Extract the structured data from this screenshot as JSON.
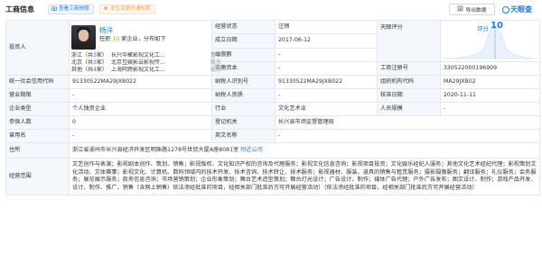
{
  "header": {
    "title": "工商信息",
    "report_btn": "查看工商快照",
    "change_btn": "发生变更时通知我",
    "export_btn": "导出数据",
    "brand": "天眼查"
  },
  "investor": {
    "label": "投资人",
    "name": "杨洋",
    "role_prefix": "任职",
    "role_count": "10",
    "role_suffix": "家企业，分布如下",
    "regions": [
      {
        "region": "浙江",
        "count_prefix": "（共",
        "count": "3",
        "count_suffix": "家）",
        "company": "长兴华聚影视文化工...",
        "role": "董事长"
      },
      {
        "region": "北京",
        "count_prefix": "（共",
        "count": "3",
        "count_suffix": "家）",
        "company": "北京互娱影云影视传...",
        "role": "股东"
      },
      {
        "region": "其他",
        "count_prefix": "（共",
        "count": "4",
        "count_suffix": "家）",
        "company": "上海阿跨影视文化工...",
        "role": "股东"
      }
    ]
  },
  "rows": {
    "status_label": "经营状态",
    "status_value": "注销",
    "founded_label": "成立日期",
    "founded_value": "2017-06-12",
    "capital_label": "出资额",
    "capital_value": "-",
    "paidin_label": "实缴资本",
    "paidin_value": "-",
    "score_label": "天眼评分",
    "regno_label": "工商注册号",
    "regno_value": "330522000196909",
    "credit_label": "统一社会信用代码",
    "credit_value": "91330522MA29JXB022",
    "taxid_label": "纳税人识别号",
    "taxid_value": "91330522MA29JXB022",
    "orgcode_label": "组织机构代码",
    "orgcode_value": "MA29JXB02",
    "term_label": "营业期限",
    "term_value": "-",
    "taxqual_label": "纳税人资质",
    "taxqual_value": "-",
    "approve_label": "核准日期",
    "approve_value": "2020-11-11",
    "type_label": "企业类型",
    "type_value": "个人独资企业",
    "industry_label": "行业",
    "industry_value": "文化艺术业",
    "staff_label": "人员规模",
    "staff_value": "-",
    "insured_label": "参保人数",
    "insured_value": "0",
    "regauth_label": "登记机关",
    "regauth_value": "长兴县市场监督管理局",
    "former_label": "曾用名",
    "former_value": "-",
    "engname_label": "英文名称",
    "engname_value": "-",
    "address_label": "住所",
    "address_value": "浙江省湖州市长兴县经济开发区明珠路1278号世贸大厦A座8081室",
    "address_link": "附近公司",
    "scope_label": "经营范围",
    "scope_value": "文艺创作与表演；影视剧本创作、策划、销售；影视版权、文化知识产权的咨询及代理服务；影视文化信息咨询；影视项目投资；文化娱乐经纪人服务；其他文化艺术经纪代理；影视策划文化活动、文体赛事；影视文化、计算机、数码领域内的技术开发、技术咨询、技术转让、技术服务；影视器材、服装、道具的销售与租赁服务；摄影摄像服务；翻译服务；礼仪服务；会务服务；展览展示服务；商务信息咨询；市场营销策划；企业形象策划；舞台艺术造型策划；舞台灯光设计；广告设计、制作；媒体广告代理；户外广告发布；图文设计、制作；游戏产品开发、设计、制作、推广、销售（含网上销售）依法须经批准的项目，经相关部门批准后方可开展经营活动）（依法须经批准的项目，经相关部门批准后方可开展经营活动）"
  },
  "score": {
    "value": "10",
    "label": "评分"
  },
  "colors": {
    "accent": "#1b7ce6",
    "label_bg": "#f4f7fb",
    "border": "#e4e8ee"
  }
}
